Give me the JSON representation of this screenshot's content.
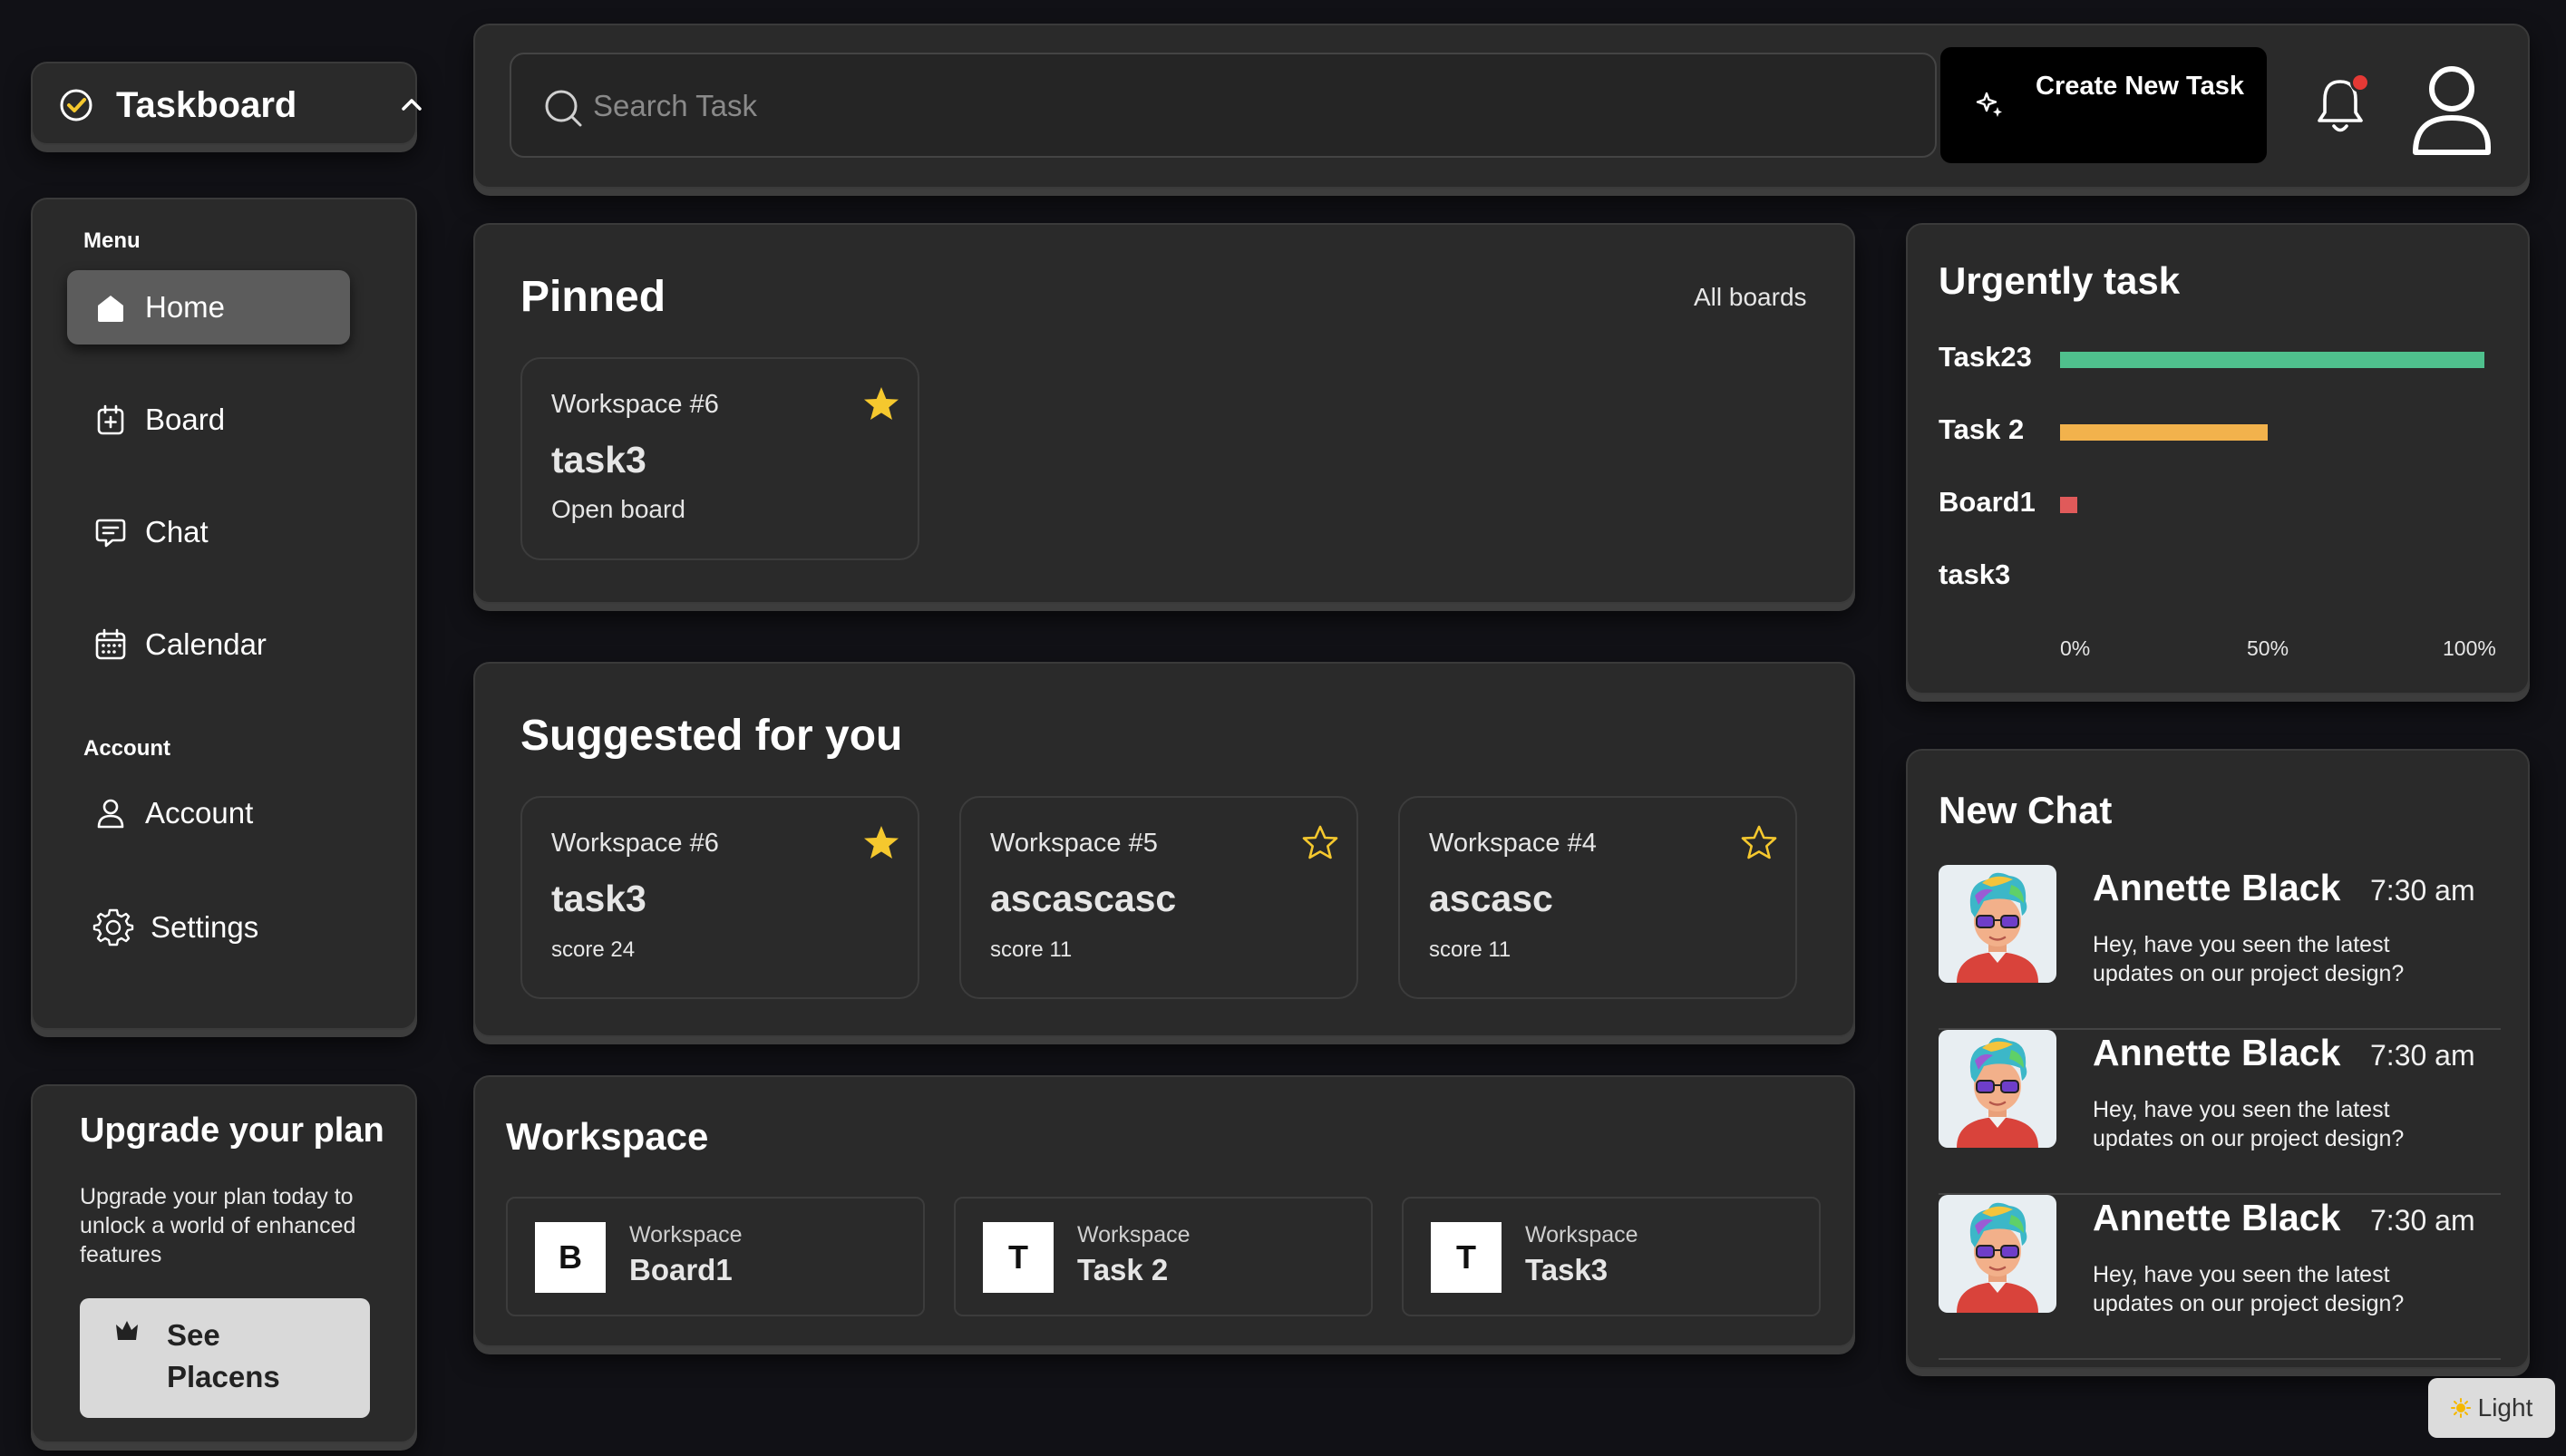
{
  "app": {
    "name": "Taskboard"
  },
  "sidebar": {
    "menu_label": "Menu",
    "items": [
      {
        "label": "Home",
        "icon": "home-icon",
        "active": true
      },
      {
        "label": "Board",
        "icon": "board-icon"
      },
      {
        "label": "Chat",
        "icon": "chat-icon"
      },
      {
        "label": "Calendar",
        "icon": "calendar-icon"
      }
    ],
    "account_label": "Account",
    "account_items": [
      {
        "label": "Account",
        "icon": "user-icon"
      },
      {
        "label": "Settings",
        "icon": "gear-icon"
      }
    ]
  },
  "upgrade": {
    "title": "Upgrade your plan",
    "description": "Upgrade your plan today to unlock a world of enhanced features",
    "button_label": "See Placens"
  },
  "topbar": {
    "search_placeholder": "Search Task",
    "create_button": "Create New Task",
    "notification_dot": true
  },
  "pinned": {
    "title": "Pinned",
    "all_boards_link": "All boards",
    "cards": [
      {
        "workspace": "Workspace #6",
        "name": "task3",
        "subtitle": "Open board",
        "starred": true
      }
    ]
  },
  "suggested": {
    "title": "Suggested for you",
    "cards": [
      {
        "workspace": "Workspace #6",
        "name": "task3",
        "score": "score 24",
        "starred": true
      },
      {
        "workspace": "Workspace #5",
        "name": "ascascasc",
        "score": "score 11",
        "starred": false
      },
      {
        "workspace": "Workspace #4",
        "name": "ascasc",
        "score": "score 11",
        "starred": false
      }
    ]
  },
  "workspace": {
    "title": "Workspace",
    "items": [
      {
        "letter": "B",
        "label": "Workspace",
        "name": "Board1"
      },
      {
        "letter": "T",
        "label": "Workspace",
        "name": "Task 2"
      },
      {
        "letter": "T",
        "label": "Workspace",
        "name": "Task3"
      }
    ]
  },
  "urgent": {
    "title": "Urgently task",
    "tasks": [
      {
        "label": "Task23",
        "percent": 100,
        "color": "#4fc08d"
      },
      {
        "label": "Task 2",
        "percent": 49,
        "color": "#f2b24c"
      },
      {
        "label": "Board1",
        "percent": 4,
        "color": "#e05a5a"
      },
      {
        "label": "task3",
        "percent": 0,
        "color": "#888888"
      }
    ],
    "axis_ticks": [
      "0%",
      "50%",
      "100%"
    ]
  },
  "chat": {
    "title": "New Chat",
    "messages": [
      {
        "name": "Annette Black",
        "time": "7:30 am",
        "text": "Hey, have you seen the latest updates on our project design?"
      },
      {
        "name": "Annette Black",
        "time": "7:30 am",
        "text": "Hey, have you seen the latest updates on our project design?"
      },
      {
        "name": "Annette Black",
        "time": "7:30 am",
        "text": "Hey, have you seen the latest updates on our project design?"
      }
    ]
  },
  "theme_toggle": {
    "label": "Light"
  },
  "colors": {
    "background": "#111116",
    "panel": "#2a2a2a",
    "star": "#f5c82e",
    "accent_green": "#4fc08d",
    "accent_orange": "#f2b24c",
    "accent_red": "#e05a5a"
  }
}
